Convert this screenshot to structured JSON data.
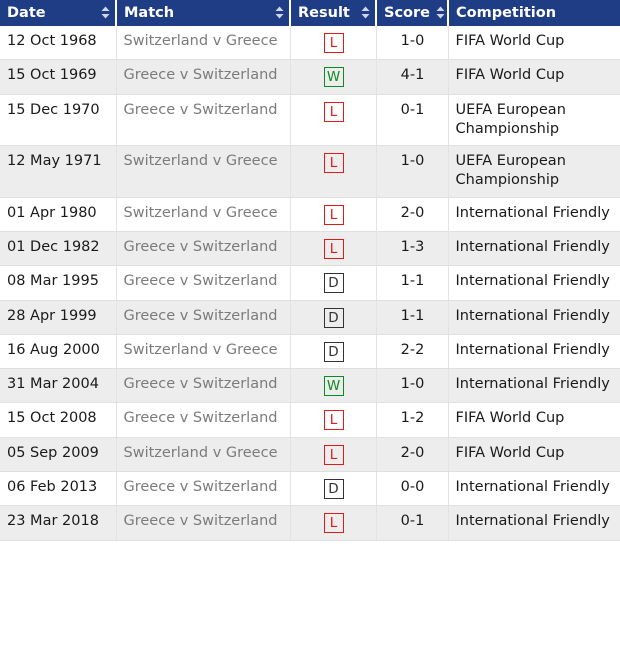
{
  "colors": {
    "header_bg": "#1f3d85",
    "header_text": "#ffffff",
    "row_alt_bg": "#ededed",
    "date_text": "#1a1a1a",
    "match_text": "#7b7b7b",
    "win": "#0f8a22",
    "loss": "#e01b1b",
    "draw": "#333333"
  },
  "table": {
    "columns": [
      {
        "key": "date",
        "label": "Date",
        "sortable": true,
        "sort_icon": "sort-updown-icon"
      },
      {
        "key": "match",
        "label": "Match",
        "sortable": true,
        "sort_icon": "sort-updown-icon"
      },
      {
        "key": "result",
        "label": "Result",
        "sortable": true,
        "sort_icon": "sort-updown-icon"
      },
      {
        "key": "score",
        "label": "Score",
        "sortable": true,
        "sort_icon": "sort-updown-icon"
      },
      {
        "key": "competition",
        "label": "Competition",
        "sortable": false,
        "sort_icon": ""
      }
    ],
    "rows": [
      {
        "date": "12 Oct 1968",
        "match": "Switzerland v Greece",
        "result": "L",
        "score": "1-0",
        "competition": "FIFA World Cup"
      },
      {
        "date": "15 Oct 1969",
        "match": "Greece v Switzerland",
        "result": "W",
        "score": "4-1",
        "competition": "FIFA World Cup"
      },
      {
        "date": "15 Dec 1970",
        "match": "Greece v Switzerland",
        "result": "L",
        "score": "0-1",
        "competition": "UEFA European Championship"
      },
      {
        "date": "12 May 1971",
        "match": "Switzerland v Greece",
        "result": "L",
        "score": "1-0",
        "competition": "UEFA European Championship"
      },
      {
        "date": "01 Apr 1980",
        "match": "Switzerland v Greece",
        "result": "L",
        "score": "2-0",
        "competition": "International Friendly"
      },
      {
        "date": "01 Dec 1982",
        "match": "Greece v Switzerland",
        "result": "L",
        "score": "1-3",
        "competition": "International Friendly"
      },
      {
        "date": "08 Mar 1995",
        "match": "Greece v Switzerland",
        "result": "D",
        "score": "1-1",
        "competition": "International Friendly"
      },
      {
        "date": "28 Apr 1999",
        "match": "Greece v Switzerland",
        "result": "D",
        "score": "1-1",
        "competition": "International Friendly"
      },
      {
        "date": "16 Aug 2000",
        "match": "Switzerland v Greece",
        "result": "D",
        "score": "2-2",
        "competition": "International Friendly"
      },
      {
        "date": "31 Mar 2004",
        "match": "Greece v Switzerland",
        "result": "W",
        "score": "1-0",
        "competition": "International Friendly"
      },
      {
        "date": "15 Oct 2008",
        "match": "Greece v Switzerland",
        "result": "L",
        "score": "1-2",
        "competition": "FIFA World Cup"
      },
      {
        "date": "05 Sep 2009",
        "match": "Switzerland v Greece",
        "result": "L",
        "score": "2-0",
        "competition": "FIFA World Cup"
      },
      {
        "date": "06 Feb 2013",
        "match": "Greece v Switzerland",
        "result": "D",
        "score": "0-0",
        "competition": "International Friendly"
      },
      {
        "date": "23 Mar 2018",
        "match": "Greece v Switzerland",
        "result": "L",
        "score": "0-1",
        "competition": "International Friendly"
      }
    ]
  }
}
